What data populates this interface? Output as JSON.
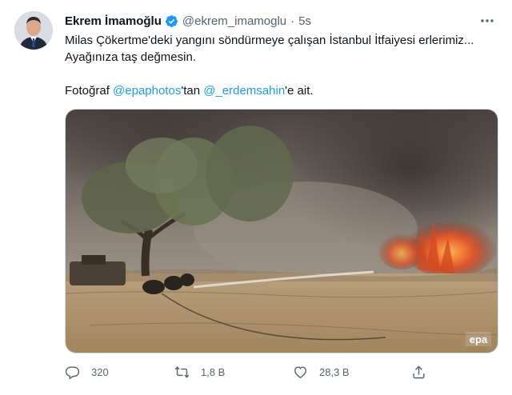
{
  "tweet": {
    "author_name": "Ekrem İmamoğlu",
    "handle": "@ekrem_imamoglu",
    "separator": "·",
    "time": "5s",
    "more_icon": "more-dots-icon",
    "text_line1": "Milas Çökertme'deki yangını söndürmeye çalışan İstanbul İtfaiyesi erlerimiz...",
    "text_line2": "Ayağınıza taş değmesin.",
    "credit_prefix": "Fotoğraf ",
    "credit_link1": "@epaphotos",
    "credit_mid": "'tan ",
    "credit_link2": "@_erdemsahin",
    "credit_suffix": "'e ait.",
    "photo_watermark": "epa",
    "link_color": "#1d9bf0",
    "verified_color": "#1d9bf0"
  },
  "actions": {
    "reply_count": "320",
    "retweet_count": "1,8 B",
    "like_count": "28,3 B",
    "share_label": ""
  }
}
